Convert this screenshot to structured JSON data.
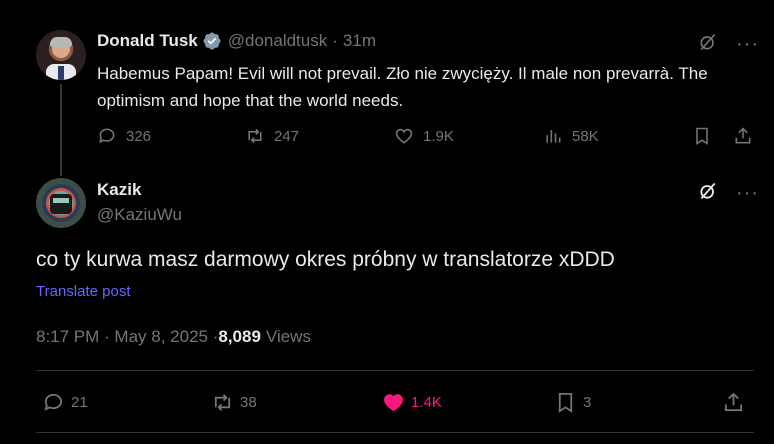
{
  "parent_tweet": {
    "author_name": "Donald Tusk",
    "verified": true,
    "handle": "@donaldtusk",
    "separator": "·",
    "time_ago": "31m",
    "text": "Habemus Papam! Evil will not prevail. Zło nie zwycięży. Il male non prevarrà. The optimism and hope that the world needs.",
    "actions": {
      "replies": "326",
      "reposts": "247",
      "likes": "1.9K",
      "views": "58K"
    },
    "more_label": "···"
  },
  "focused_reply": {
    "author_name": "Kazik",
    "handle": "@KaziuWu",
    "text": "co ty kurwa masz darmowy okres próbny w translatorze xDDD",
    "translate_label": "Translate post",
    "timestamp": "8:17 PM · May 8, 2025 · ",
    "views_count": "8,089",
    "views_label": "Views",
    "actions": {
      "replies": "21",
      "reposts": "38",
      "likes": "1.4K",
      "bookmarks": "3"
    },
    "liked": true,
    "more_label": "···"
  },
  "colors": {
    "background": "#000000",
    "primary_text": "#e7e9ea",
    "secondary_text": "#71767b",
    "link": "#6b63ff",
    "like_active": "#f91880",
    "verified_badge": "#829aab",
    "divider": "#2f3336"
  },
  "icons": {
    "reply": "reply-icon",
    "repost": "repost-icon",
    "like": "heart-icon",
    "views": "analytics-icon",
    "bookmark": "bookmark-icon",
    "share": "share-icon",
    "grok": "grok-icon",
    "more": "more-icon",
    "verified": "verified-badge-icon"
  }
}
